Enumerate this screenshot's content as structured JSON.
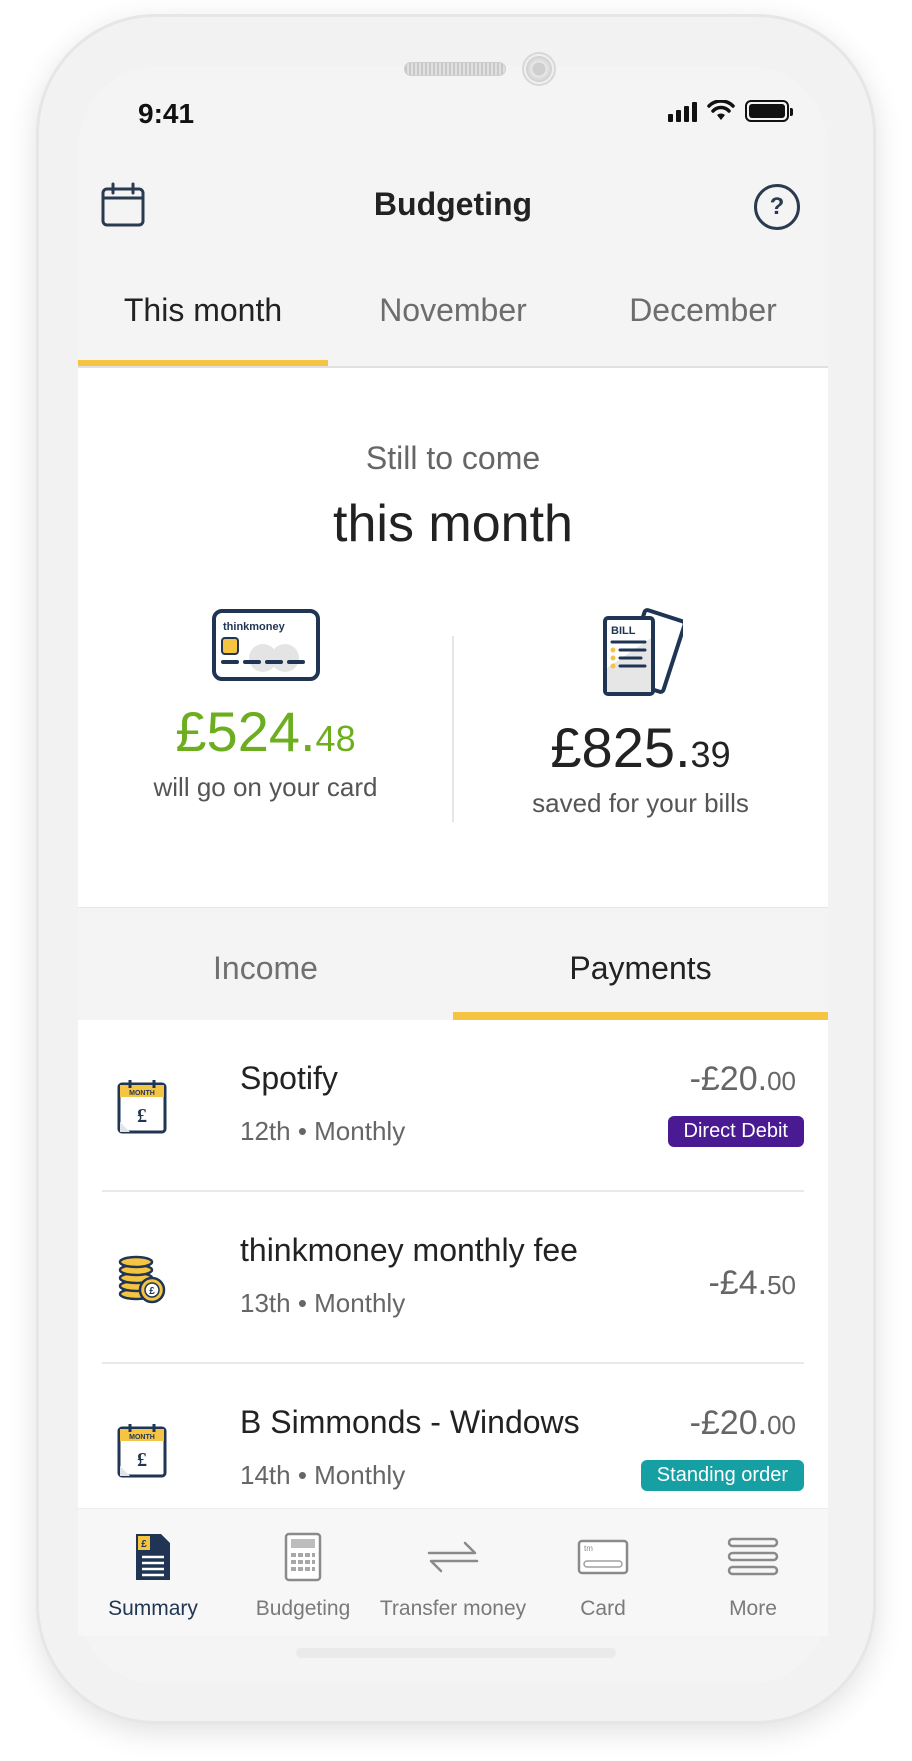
{
  "status": {
    "time": "9:41"
  },
  "header": {
    "title": "Budgeting",
    "help_label": "?"
  },
  "month_tabs": [
    {
      "label": "This month",
      "active": true
    },
    {
      "label": "November",
      "active": false
    },
    {
      "label": "December",
      "active": false
    }
  ],
  "summary": {
    "subtitle": "Still to come",
    "title": "this month",
    "card": {
      "brand": "thinkmoney",
      "amount_main": "£524.",
      "amount_pence": "48",
      "label": "will go on your card"
    },
    "bills": {
      "icon_text": "BILL",
      "amount_main": "£825.",
      "amount_pence": "39",
      "label": "saved for your bills"
    }
  },
  "sub_tabs": [
    {
      "label": "Income",
      "active": false
    },
    {
      "label": "Payments",
      "active": true
    }
  ],
  "payments": [
    {
      "name": "Spotify",
      "meta": "12th • Monthly",
      "amount_main": "-£20.",
      "amount_pence": "00",
      "badge": "Direct Debit",
      "icon": "calendar-pound-icon"
    },
    {
      "name": "thinkmoney monthly fee",
      "meta": "13th • Monthly",
      "amount_main": "-£4.",
      "amount_pence": "50",
      "badge": "",
      "icon": "coins-icon"
    },
    {
      "name": "B Simmonds - Windows",
      "meta": "14th • Monthly",
      "amount_main": "-£20.",
      "amount_pence": "00",
      "badge": "Standing order",
      "icon": "calendar-pound-icon"
    }
  ],
  "calendar_icon_text": "MONTH",
  "bottom_nav": [
    {
      "label": "Summary",
      "icon": "summary-icon",
      "active": true
    },
    {
      "label": "Budgeting",
      "icon": "calculator-icon",
      "active": false
    },
    {
      "label": "Transfer money",
      "icon": "transfer-icon",
      "active": false
    },
    {
      "label": "Card",
      "icon": "card-icon",
      "active": false
    },
    {
      "label": "More",
      "icon": "menu-icon",
      "active": false
    }
  ],
  "colors": {
    "accent": "#f5c443",
    "green": "#6cae1f",
    "navy": "#1f3553",
    "direct_debit": "#4a1a93",
    "standing_order": "#17a0a4"
  }
}
